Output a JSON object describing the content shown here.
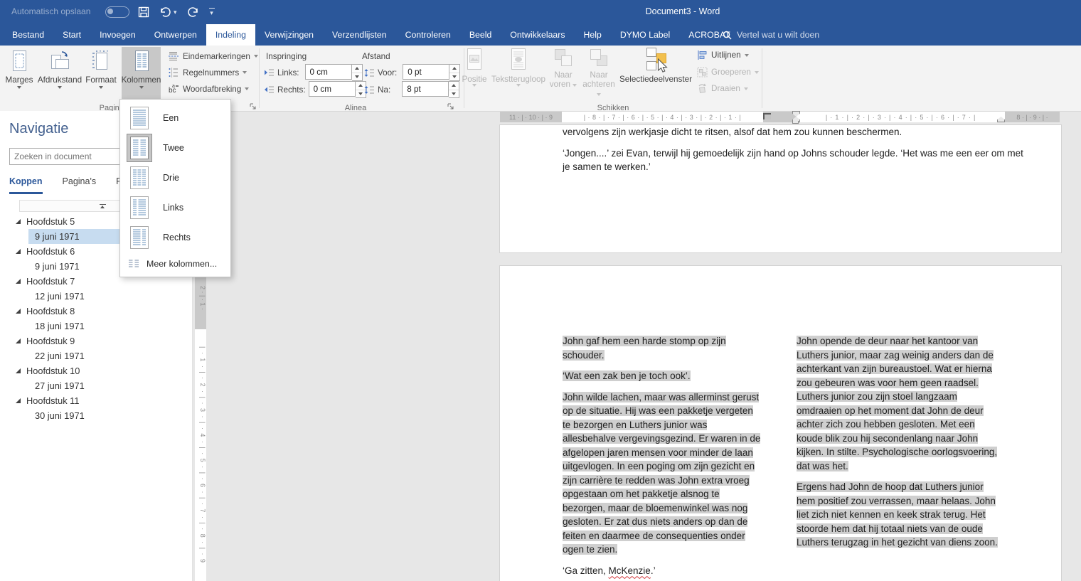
{
  "titlebar": {
    "autosave_label": "Automatisch opslaan",
    "title": "Document3 - Word"
  },
  "tabs": [
    {
      "label": "Bestand"
    },
    {
      "label": "Start"
    },
    {
      "label": "Invoegen"
    },
    {
      "label": "Ontwerpen"
    },
    {
      "label": "Indeling",
      "active": true
    },
    {
      "label": "Verwijzingen"
    },
    {
      "label": "Verzendlijsten"
    },
    {
      "label": "Controleren"
    },
    {
      "label": "Beeld"
    },
    {
      "label": "Ontwikkelaars"
    },
    {
      "label": "Help"
    },
    {
      "label": "DYMO Label"
    },
    {
      "label": "ACROBAT"
    }
  ],
  "tellme_label": "Vertel wat u wilt doen",
  "ribbon": {
    "page_setup": {
      "margins_label": "Marges",
      "orientation_label": "Afdrukstand",
      "size_label": "Formaat",
      "columns_label": "Kolommen",
      "breaks_label": "Eindemarkeringen",
      "line_numbers_label": "Regelnummers",
      "hyphenation_label": "Woordafbreking",
      "group_label": "Pagina-instelling"
    },
    "paragraph": {
      "indent_heading": "Inspringing",
      "spacing_heading": "Afstand",
      "left_label": "Links:",
      "left_value": "0 cm",
      "right_label": "Rechts:",
      "right_value": "0 cm",
      "before_label": "Voor:",
      "before_value": "0 pt",
      "after_label": "Na:",
      "after_value": "8 pt",
      "group_label": "Alinea"
    },
    "arrange": {
      "position_label": "Positie",
      "wrap_label": "Tekstterugloop",
      "forward_label1": "Naar",
      "forward_label2": "voren",
      "backward_label1": "Naar",
      "backward_label2": "achteren",
      "selection_pane_label": "Selectiedeelvenster",
      "align_label": "Uitlijnen",
      "group_btn_label": "Groeperen",
      "rotate_label": "Draaien",
      "group_label": "Schikken"
    }
  },
  "columns_menu": {
    "items": [
      {
        "label": "Een"
      },
      {
        "label": "Twee",
        "selected": true
      },
      {
        "label": "Drie"
      },
      {
        "label": "Links"
      },
      {
        "label": "Rechts"
      }
    ],
    "more_label": "Meer kolommen..."
  },
  "navigation": {
    "title": "Navigatie",
    "search_placeholder": "Zoeken in document",
    "tabs": [
      {
        "label": "Koppen",
        "active": true
      },
      {
        "label": "Pagina's"
      },
      {
        "label": "Resultaten"
      }
    ],
    "items": [
      {
        "label": "Hoofdstuk 5",
        "level": 1
      },
      {
        "label": "9 juni 1971",
        "level": 2,
        "selected": true
      },
      {
        "label": "Hoofdstuk 6",
        "level": 1
      },
      {
        "label": "9 juni 1971",
        "level": 2
      },
      {
        "label": "Hoofdstuk 7",
        "level": 1
      },
      {
        "label": "12 juni 1971",
        "level": 2
      },
      {
        "label": "Hoofdstuk 8",
        "level": 1
      },
      {
        "label": "18 juni 1971",
        "level": 2
      },
      {
        "label": "Hoofdstuk 9",
        "level": 1
      },
      {
        "label": "22 juni 1971",
        "level": 2
      },
      {
        "label": "Hoofdstuk 10",
        "level": 1
      },
      {
        "label": "27 juni 1971",
        "level": 2
      },
      {
        "label": "Hoofdstuk 11",
        "level": 1
      },
      {
        "label": "30 juni 1971",
        "level": 2
      }
    ]
  },
  "ruler": {
    "h_margin_left": "11 · | · 10 · | · 9",
    "h_col1": "| · 8 · | · 7 · | · 6 · | · 5 · | · 4 · | · 3 · | · 2 · | · 1 · |",
    "h_col2": "| · 1 · | · 2 · | · 3 · | · 4 · | · 5 · | · 6 · | · 7 · |",
    "h_margin_right": "8 · | · 9 · | ·",
    "v_margin": "2 · | · 1 ·",
    "v_area": "| · 1 · | · 2 · | · 3 · | · 4 · | · 5 · | · 6 · | · 7 · | · 8 · | · 9"
  },
  "document": {
    "page1": {
      "para1": "vervolgens zijn werkjasje dicht te ritsen, alsof dat hem zou kunnen beschermen.",
      "para2": "‘Jongen....’ zei Evan, terwijl hij gemoedelijk zijn hand op Johns schouder legde. ‘Het was me een eer om met je samen te werken.’"
    },
    "page2": {
      "left_column": {
        "para1": "John gaf hem een harde stomp op zijn schouder.",
        "para2": "‘Wat een zak ben je toch ook’.",
        "para3": "John wilde lachen, maar was allerminst gerust op de situatie. Hij was een pakketje vergeten te bezorgen en Luthers junior was allesbehalve vergevingsgezind. Er waren in de afgelopen jaren mensen voor minder de laan uitgevlogen. In een poging om zijn gezicht en zijn carrière te redden was John extra vroeg opgestaan om het pakketje alsnog te bezorgen, maar de bloemenwinkel was nog gesloten. Er zat dus niets anders op dan de feiten en daarmee de consequenties onder ogen te zien.",
        "para4_prefix": "‘Ga zitten, ",
        "para4_misspelled": "McKenzie",
        "para4_suffix": ".’"
      },
      "right_column": {
        "para1": "John opende de deur naar het kantoor van Luthers junior, maar zag weinig anders dan de achterkant van zijn bureaustoel. Wat er hierna zou gebeuren was voor hem geen raadsel. Luthers junior zou zijn stoel langzaam omdraaien op het moment dat John de deur achter zich zou hebben gesloten. Met een koude blik zou hij secondenlang naar John kijken. In stilte. Psychologische oorlogsvoering, dat was het.",
        "para2": "Ergens had John de hoop dat Luthers junior hem positief zou verrassen, maar helaas. John liet zich niet kennen en keek strak terug. Het stoorde hem dat hij totaal niets van de oude Luthers terugzag in het gezicht van diens zoon."
      }
    }
  }
}
